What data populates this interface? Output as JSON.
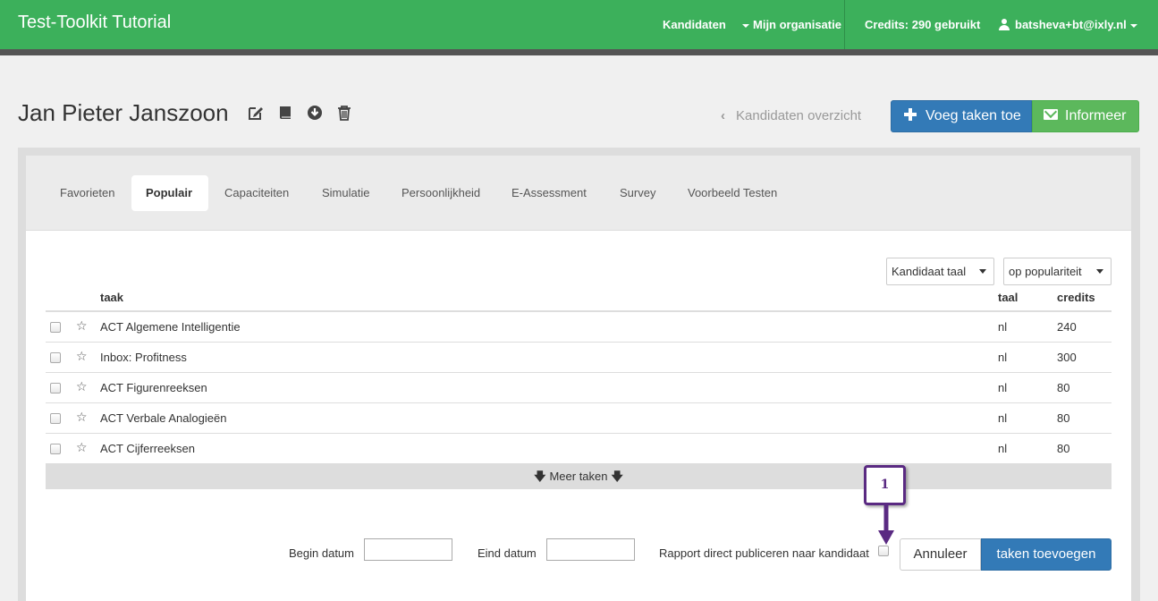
{
  "navbar": {
    "brand": "Test-Toolkit Tutorial",
    "items": [
      {
        "label": "Kandidaten"
      },
      {
        "label": "Mijn organisatie"
      },
      {
        "label": "Credits: 290 gebruikt"
      },
      {
        "label": "batsheva+bt@ixly.nl"
      }
    ]
  },
  "header": {
    "title": "Jan Pieter Janszoon",
    "back_label": "Kandidaten overzicht",
    "add_tasks_label": "Voeg taken toe",
    "inform_label": "Informeer"
  },
  "tabs": [
    {
      "label": "Favorieten"
    },
    {
      "label": "Populair",
      "active": true
    },
    {
      "label": "Capaciteiten"
    },
    {
      "label": "Simulatie"
    },
    {
      "label": "Persoonlijkheid"
    },
    {
      "label": "E-Assessment"
    },
    {
      "label": "Survey"
    },
    {
      "label": "Voorbeeld Testen"
    }
  ],
  "filters": {
    "language_select": "Kandidaat taal",
    "sort_select": "op populariteit"
  },
  "table": {
    "headers": {
      "task": "taak",
      "language": "taal",
      "credits": "credits"
    },
    "rows": [
      {
        "name": "ACT Algemene Intelligentie",
        "language": "nl",
        "credits": "240"
      },
      {
        "name": "Inbox: Profitness",
        "language": "nl",
        "credits": "300"
      },
      {
        "name": "ACT Figurenreeksen",
        "language": "nl",
        "credits": "80"
      },
      {
        "name": "ACT Verbale Analogieën",
        "language": "nl",
        "credits": "80"
      },
      {
        "name": "ACT Cijferreeksen",
        "language": "nl",
        "credits": "80"
      }
    ],
    "more_label": "Meer taken"
  },
  "form": {
    "begin_label": "Begin datum",
    "end_label": "Eind datum",
    "publish_label": "Rapport direct publiceren naar kandidaat",
    "cancel_label": "Annuleer",
    "submit_label": "taken toevoegen"
  },
  "annotation": {
    "number": "1"
  },
  "colors": {
    "navbar": "#3cb05b",
    "primary": "#337ab7",
    "success": "#5cb85c",
    "annotation": "#5a2a82"
  }
}
